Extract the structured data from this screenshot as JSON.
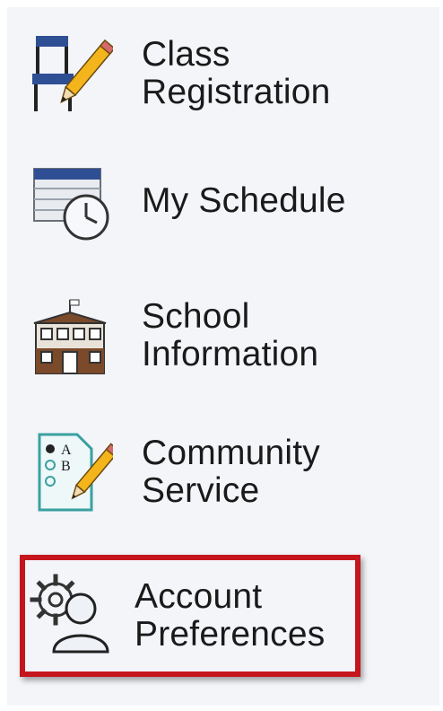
{
  "menu": {
    "items": [
      {
        "label": "Class\nRegistration",
        "icon": "class-registration-icon"
      },
      {
        "label": "My Schedule",
        "icon": "schedule-clock-icon"
      },
      {
        "label": "School\nInformation",
        "icon": "school-building-icon"
      },
      {
        "label": "Community\nService",
        "icon": "community-service-checklist-icon"
      },
      {
        "label": "Account\nPreferences",
        "icon": "account-preferences-user-gear-icon",
        "selected": true
      }
    ]
  },
  "colors": {
    "panel_bg": "#f3f5f9",
    "selection_border": "#c4161c",
    "label_text": "#1a1a1a",
    "icon_blue": "#2f4f94",
    "icon_brown": "#7a4a2a",
    "icon_teal": "#3aa0a0"
  }
}
